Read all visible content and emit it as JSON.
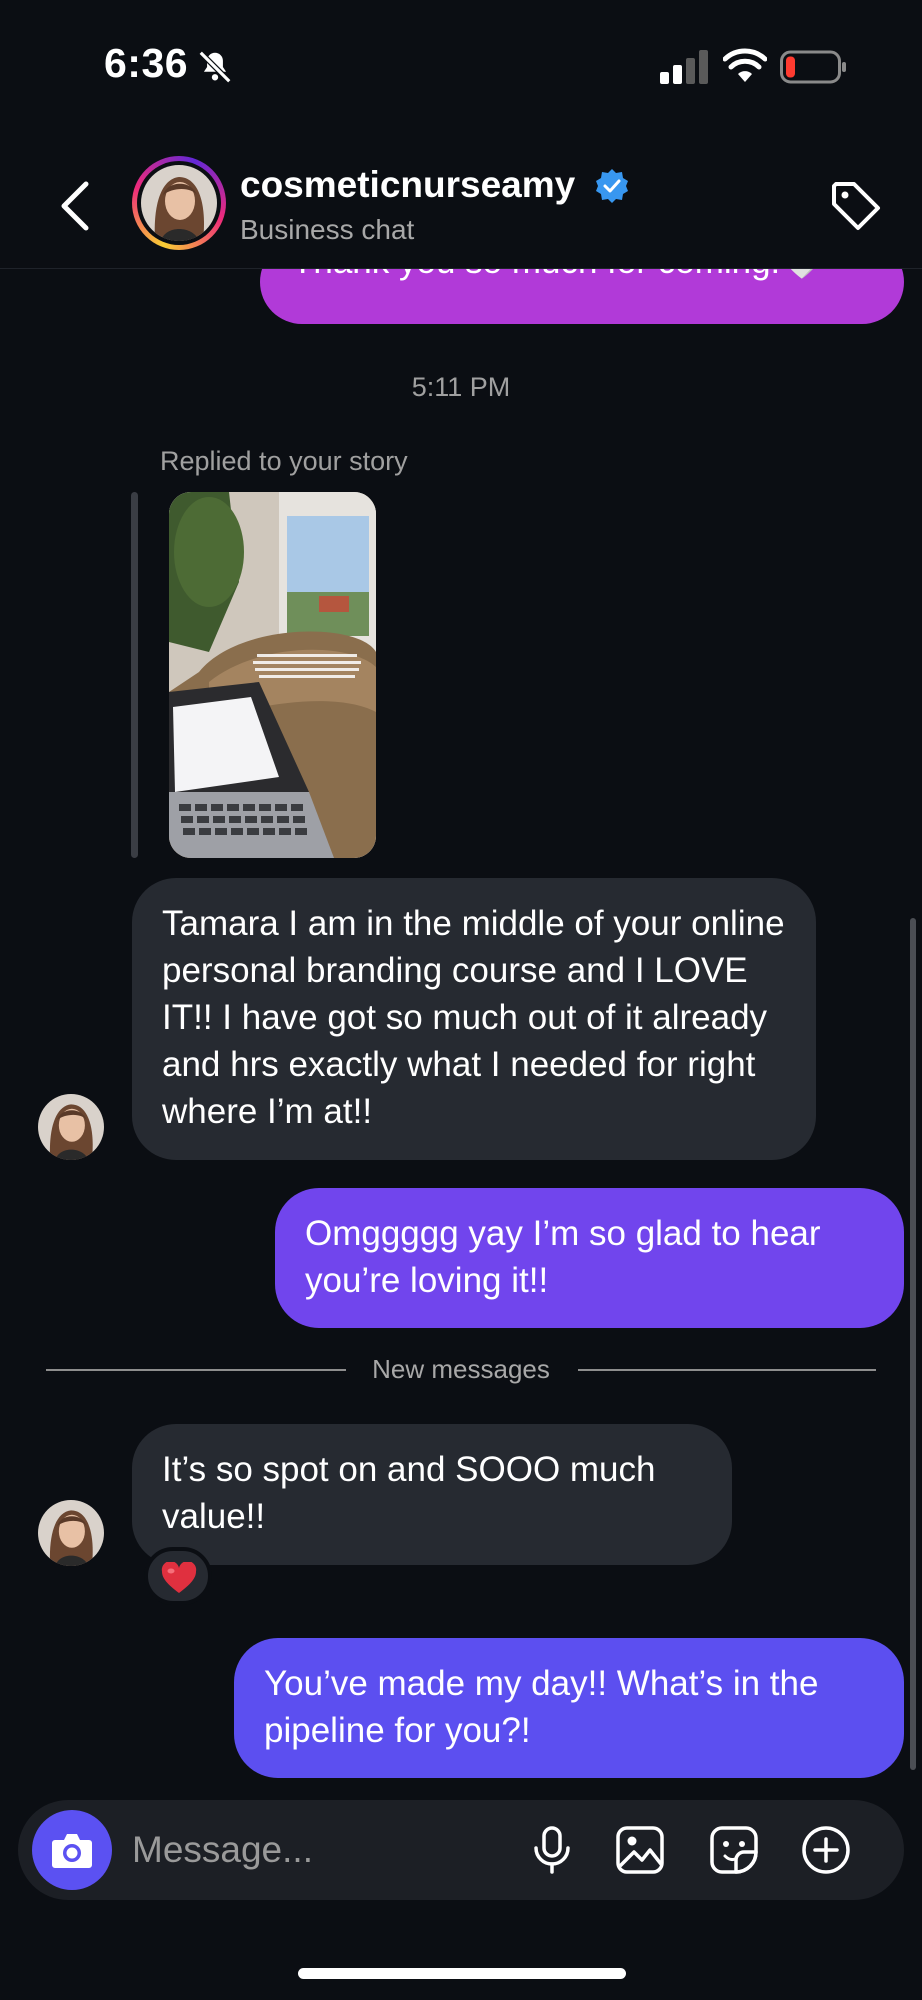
{
  "status_bar": {
    "time": "6:36"
  },
  "header": {
    "username": "cosmeticnurseamy",
    "subtitle": "Business chat"
  },
  "messages": {
    "top_outgoing": "Thank you so much for coming!🤍",
    "timestamp": "5:11 PM",
    "replied_label": "Replied to your story",
    "incoming_1": "Tamara I am in the middle of your online personal branding course and I LOVE IT!! I have got so much out of it already and hrs exactly what I needed for right where I’m at!!",
    "outgoing_1": "Omggggg yay I’m so glad to hear you’re loving it!!",
    "new_messages_label": "New messages",
    "incoming_2": "It’s so spot on and SOOO much value!!",
    "reaction": "❤️",
    "outgoing_2": "You’ve made my day!! What’s in the pipeline for you?!"
  },
  "composer": {
    "placeholder": "Message..."
  },
  "colors": {
    "background": "#0b0e13",
    "incoming_bubble": "#262a31",
    "outgoing_bubble_1": "#7145ed",
    "outgoing_bubble_2": "#5c4ff0",
    "outgoing_bubble_top": "#b13ad8",
    "camera_button": "#5b51f2",
    "verified": "#3897f0"
  },
  "icons": [
    "bell-slash-icon",
    "signal-icon",
    "wifi-icon",
    "battery-icon",
    "back-icon",
    "verified-icon",
    "tag-icon",
    "camera-icon",
    "mic-icon",
    "gallery-icon",
    "sticker-icon",
    "plus-icon"
  ]
}
